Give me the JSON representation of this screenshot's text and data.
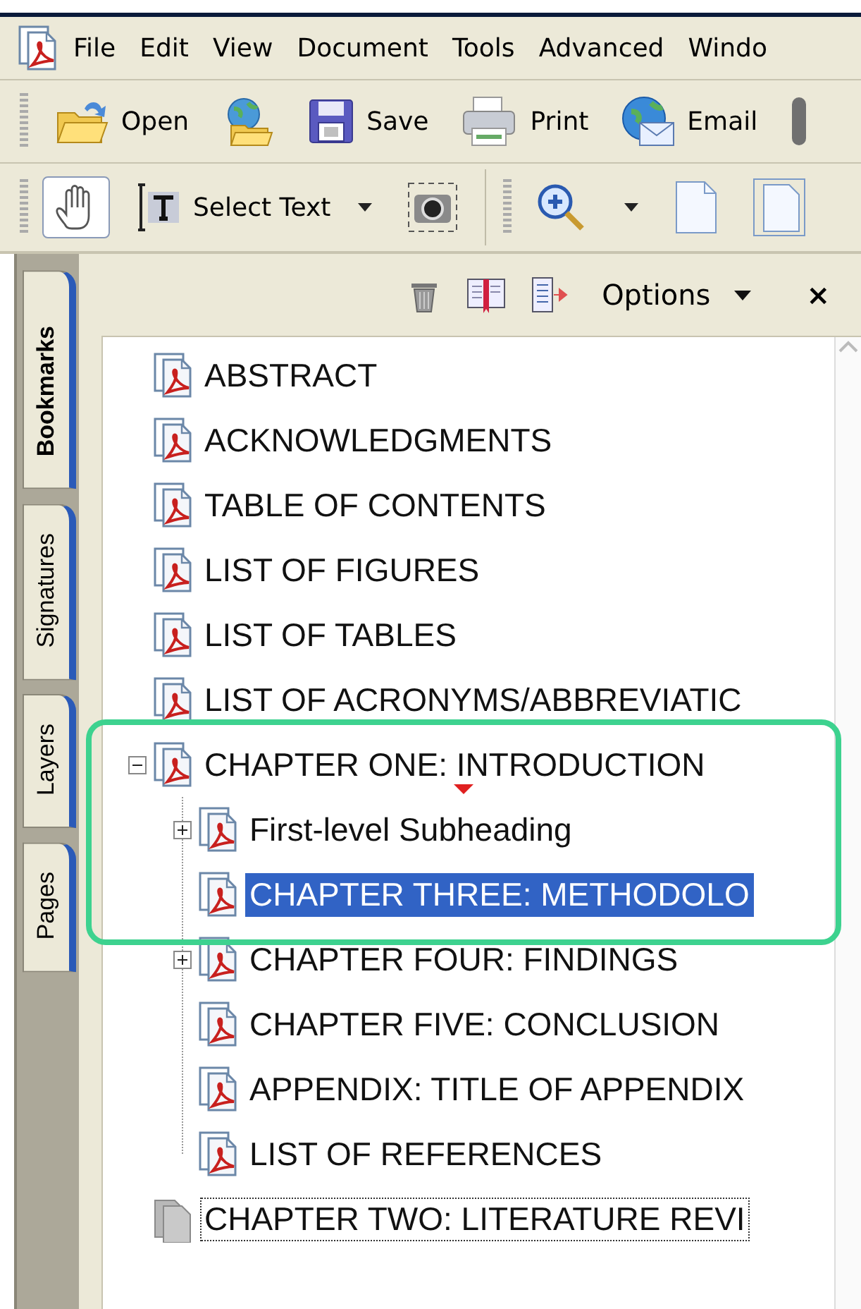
{
  "menu_bar": {
    "items": [
      "File",
      "Edit",
      "View",
      "Document",
      "Tools",
      "Advanced",
      "Windo"
    ]
  },
  "toolbar": {
    "items": [
      {
        "kind": "open",
        "label": "Open"
      },
      {
        "kind": "organizer"
      },
      {
        "kind": "save",
        "label": "Save"
      },
      {
        "kind": "print",
        "label": "Print"
      },
      {
        "kind": "email",
        "label": "Email"
      },
      {
        "kind": "clip"
      }
    ]
  },
  "tools_toolbar": {
    "items": [
      {
        "kind": "hand",
        "selected": true
      },
      {
        "kind": "select",
        "label": "Select Text"
      },
      {
        "kind": "snapshot",
        "selected": false
      },
      {
        "kind": "separator"
      },
      {
        "kind": "zoom"
      },
      {
        "kind": "page"
      },
      {
        "kind": "page2"
      }
    ]
  },
  "side_tabs": [
    {
      "label": "Bookmarks",
      "selected": true
    },
    {
      "label": "Signatures",
      "selected": false
    },
    {
      "label": "Layers",
      "selected": false
    },
    {
      "label": "Pages",
      "selected": false
    }
  ],
  "panel_header": {
    "options": "Options",
    "close": "×"
  },
  "bookmarks": [
    {
      "title": "ABSTRACT",
      "kind": "pdf",
      "selected": false
    },
    {
      "title": "ACKNOWLEDGMENTS",
      "kind": "pdf",
      "selected": false
    },
    {
      "title": "TABLE OF CONTENTS",
      "kind": "pdf",
      "selected": false
    },
    {
      "title": "LIST OF FIGURES",
      "kind": "pdf",
      "selected": false
    },
    {
      "title": "LIST OF TABLES",
      "kind": "pdf",
      "selected": false
    },
    {
      "title": "LIST OF ACRONYMS/ABBREVIATIC",
      "kind": "pdf",
      "selected": false
    },
    {
      "title": "CHAPTER ONE: INTRODUCTION",
      "kind": "pdf",
      "selected": false,
      "expanded": true,
      "children": [
        {
          "title": "First-level Subheading",
          "kind": "pdf",
          "selected": false,
          "expanded": false
        },
        {
          "title": "CHAPTER THREE: METHODOLO",
          "kind": "pdf",
          "selected": true
        },
        {
          "title": "CHAPTER FOUR: FINDINGS",
          "kind": "pdf",
          "selected": false,
          "expanded": false
        },
        {
          "title": "CHAPTER FIVE: CONCLUSION",
          "kind": "pdf",
          "selected": false
        },
        {
          "title": "APPENDIX: TITLE OF APPENDIX",
          "kind": "pdf",
          "selected": false
        },
        {
          "title": "LIST OF REFERENCES",
          "kind": "pdf",
          "selected": false
        }
      ]
    },
    {
      "title": "CHAPTER TWO: LITERATURE REVI",
      "kind": "blank",
      "selected": false,
      "focused": true
    }
  ]
}
